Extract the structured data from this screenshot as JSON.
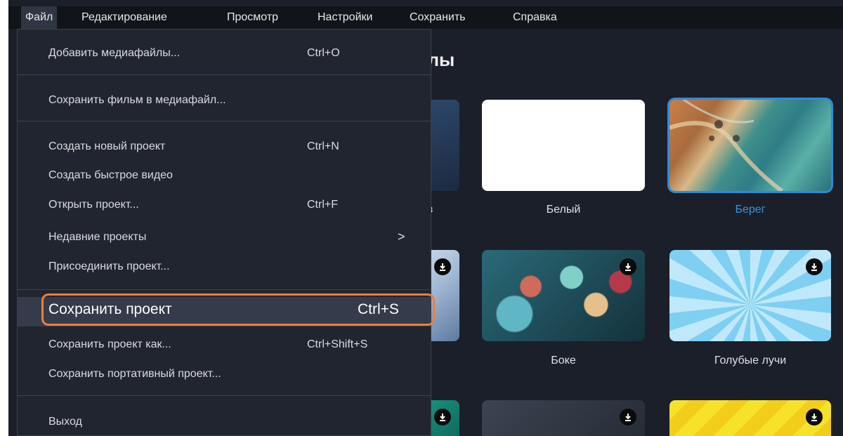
{
  "menubar": {
    "items": [
      {
        "label": "Файл"
      },
      {
        "label": "Редактирование"
      },
      {
        "label": "Просмотр"
      },
      {
        "label": "Настройки"
      },
      {
        "label": "Сохранить"
      },
      {
        "label": "Справка"
      }
    ]
  },
  "section": {
    "title_fragment": "айлы"
  },
  "tiles": [
    {
      "label": "в",
      "download": false
    },
    {
      "label": "Белый",
      "download": false
    },
    {
      "label": "Берег",
      "download": false,
      "selected": true
    },
    {
      "label": "",
      "download": true
    },
    {
      "label": "Боке",
      "download": true
    },
    {
      "label": "Голубые лучи",
      "download": true
    },
    {
      "label": "",
      "download": true
    },
    {
      "label": "",
      "download": true
    },
    {
      "label": "",
      "download": true
    }
  ],
  "file_menu": {
    "items": [
      {
        "label": "Добавить медиафайлы...",
        "shortcut": "Ctrl+O"
      },
      {
        "label": "Сохранить фильм в медиафайл...",
        "shortcut": ""
      },
      {
        "label": "Создать новый проект",
        "shortcut": "Ctrl+N"
      },
      {
        "label": "Создать быстрое видео",
        "shortcut": ""
      },
      {
        "label": "Открыть проект...",
        "shortcut": "Ctrl+F"
      },
      {
        "label": "Недавние проекты",
        "shortcut": "",
        "submenu": ">"
      },
      {
        "label": "Присоединить проект...",
        "shortcut": ""
      },
      {
        "label": "Сохранить проект",
        "shortcut": "Ctrl+S",
        "highlighted": true
      },
      {
        "label": "Сохранить проект как...",
        "shortcut": "Ctrl+Shift+S"
      },
      {
        "label": "Сохранить портативный проект...",
        "shortcut": ""
      },
      {
        "label": "Выход",
        "shortcut": ""
      }
    ]
  },
  "colors": {
    "accent_selection": "#2f8bd8",
    "highlight_ring": "#ee7e3b",
    "menu_bg": "#21252f",
    "app_bg": "#1b1f29"
  },
  "icons": {
    "download": "download-icon",
    "submenu_arrow": "chevron-right-icon"
  }
}
